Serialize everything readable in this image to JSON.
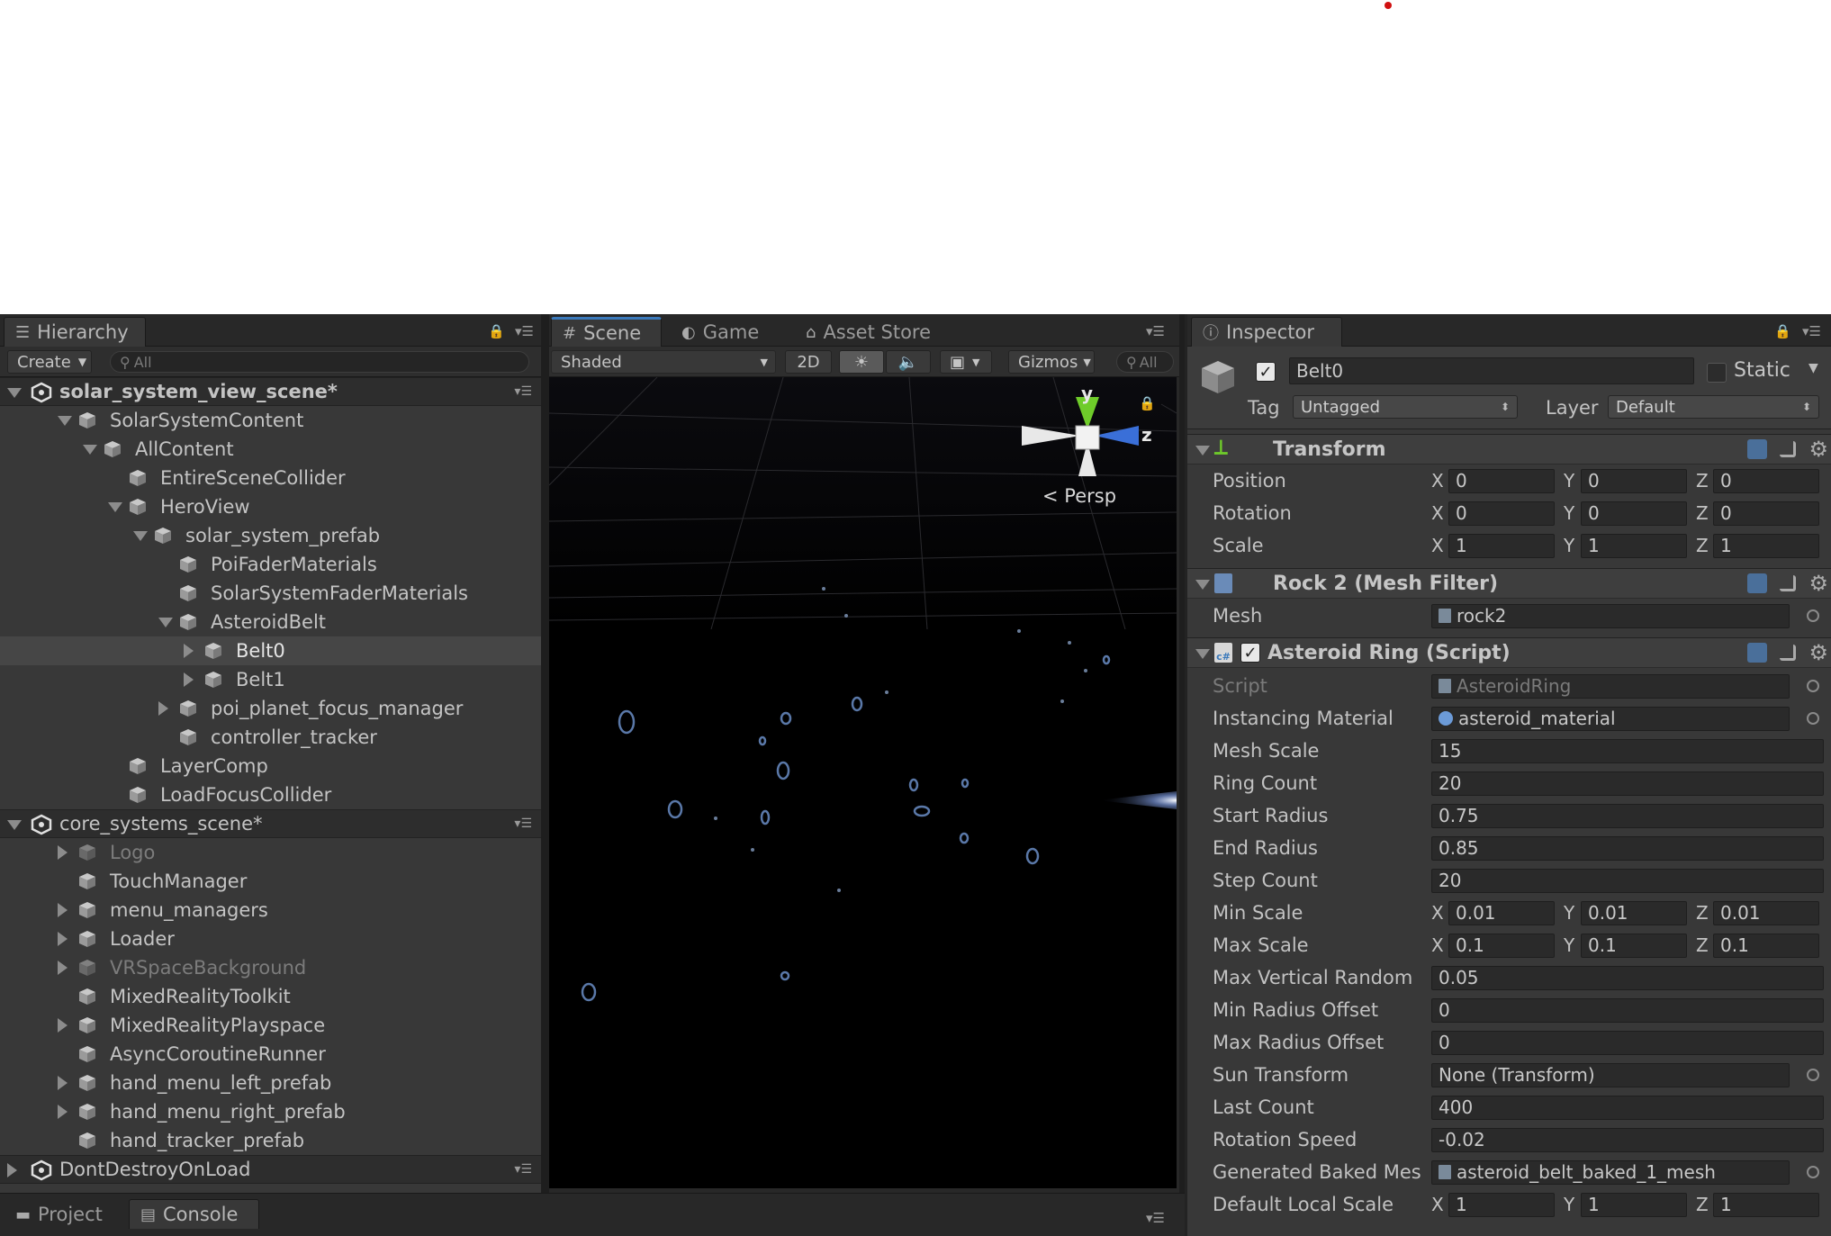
{
  "hierarchy": {
    "tab_label": "Hierarchy",
    "create_label": "Create",
    "search_placeholder": "All",
    "rows": [
      {
        "label": "solar_system_view_scene*",
        "kind": "scene",
        "expanded": true
      },
      {
        "label": "SolarSystemContent",
        "depth": 1,
        "expanded": true
      },
      {
        "label": "AllContent",
        "depth": 2,
        "expanded": true
      },
      {
        "label": "EntireSceneCollider",
        "depth": 3
      },
      {
        "label": "HeroView",
        "depth": 3,
        "expanded": true
      },
      {
        "label": "solar_system_prefab",
        "depth": 4,
        "expanded": true
      },
      {
        "label": "PoiFaderMaterials",
        "depth": 5
      },
      {
        "label": "SolarSystemFaderMaterials",
        "depth": 5
      },
      {
        "label": "AsteroidBelt",
        "depth": 5,
        "expanded": true
      },
      {
        "label": "Belt0",
        "depth": 6,
        "collapsed": true,
        "selected": true
      },
      {
        "label": "Belt1",
        "depth": 6,
        "collapsed": true
      },
      {
        "label": "poi_planet_focus_manager",
        "depth": 5,
        "collapsed": true
      },
      {
        "label": "controller_tracker",
        "depth": 5
      },
      {
        "label": "LayerComp",
        "depth": 3
      },
      {
        "label": "LoadFocusCollider",
        "depth": 3
      },
      {
        "label": "core_systems_scene*",
        "kind": "scene-plain",
        "expanded": true
      },
      {
        "label": "Logo",
        "depth": 1,
        "collapsed": true,
        "dim": true
      },
      {
        "label": "TouchManager",
        "depth": 1
      },
      {
        "label": "menu_managers",
        "depth": 1,
        "collapsed": true
      },
      {
        "label": "Loader",
        "depth": 1,
        "collapsed": true
      },
      {
        "label": "VRSpaceBackground",
        "depth": 1,
        "collapsed": true,
        "dim": true
      },
      {
        "label": "MixedRealityToolkit",
        "depth": 1
      },
      {
        "label": "MixedRealityPlayspace",
        "depth": 1,
        "collapsed": true
      },
      {
        "label": "AsyncCoroutineRunner",
        "depth": 1
      },
      {
        "label": "hand_menu_left_prefab",
        "depth": 1,
        "collapsed": true
      },
      {
        "label": "hand_menu_right_prefab",
        "depth": 1,
        "collapsed": true
      },
      {
        "label": "hand_tracker_prefab",
        "depth": 1
      },
      {
        "label": "DontDestroyOnLoad",
        "kind": "scene-plain",
        "collapsed": true
      }
    ]
  },
  "bottom_tabs": {
    "project": "Project",
    "console": "Console"
  },
  "scene": {
    "tabs": {
      "scene": "Scene",
      "game": "Game",
      "asset_store": "Asset Store"
    },
    "shading_mode": "Shaded",
    "mode_2d": "2D",
    "gizmos_label": "Gizmos",
    "search_placeholder": "All",
    "gizmo": {
      "y": "y",
      "z": "z",
      "projection": "Persp"
    }
  },
  "inspector": {
    "tab_label": "Inspector",
    "object_name": "Belt0",
    "active": true,
    "static_label": "Static",
    "tag_label": "Tag",
    "tag_value": "Untagged",
    "layer_label": "Layer",
    "layer_value": "Default",
    "transform": {
      "title": "Transform",
      "position": {
        "label": "Position",
        "x": "0",
        "y": "0",
        "z": "0"
      },
      "rotation": {
        "label": "Rotation",
        "x": "0",
        "y": "0",
        "z": "0"
      },
      "scale": {
        "label": "Scale",
        "x": "1",
        "y": "1",
        "z": "1"
      }
    },
    "mesh_filter": {
      "title": "Rock 2 (Mesh Filter)",
      "mesh_label": "Mesh",
      "mesh_value": "rock2"
    },
    "asteroid_ring": {
      "title": "Asteroid Ring (Script)",
      "script_label": "Script",
      "script_value": "AsteroidRing",
      "instancing_material_label": "Instancing Material",
      "instancing_material_value": "asteroid_material",
      "mesh_scale_label": "Mesh Scale",
      "mesh_scale_value": "15",
      "ring_count_label": "Ring Count",
      "ring_count_value": "20",
      "start_radius_label": "Start Radius",
      "start_radius_value": "0.75",
      "end_radius_label": "End Radius",
      "end_radius_value": "0.85",
      "step_count_label": "Step Count",
      "step_count_value": "20",
      "min_scale": {
        "label": "Min Scale",
        "x": "0.01",
        "y": "0.01",
        "z": "0.01"
      },
      "max_scale": {
        "label": "Max Scale",
        "x": "0.1",
        "y": "0.1",
        "z": "0.1"
      },
      "max_vertical_random_label": "Max Vertical Random",
      "max_vertical_random_value": "0.05",
      "min_radius_offset_label": "Min Radius Offset",
      "min_radius_offset_value": "0",
      "max_radius_offset_label": "Max Radius Offset",
      "max_radius_offset_value": "0",
      "sun_transform_label": "Sun Transform",
      "sun_transform_value": "None (Transform)",
      "last_count_label": "Last Count",
      "last_count_value": "400",
      "rotation_speed_label": "Rotation Speed",
      "rotation_speed_value": "-0.02",
      "generated_baked_mesh_label": "Generated Baked Mes",
      "generated_baked_mesh_value": "asteroid_belt_baked_1_mesh",
      "default_local_scale": {
        "label": "Default Local Scale",
        "x": "1",
        "y": "1",
        "z": "1"
      }
    }
  },
  "axis_labels": {
    "x": "X",
    "y": "Y",
    "z": "Z"
  },
  "colors": {
    "accent": "#3a79bb",
    "background": "#383838",
    "viewport": "#000000",
    "selection": "#464646"
  }
}
